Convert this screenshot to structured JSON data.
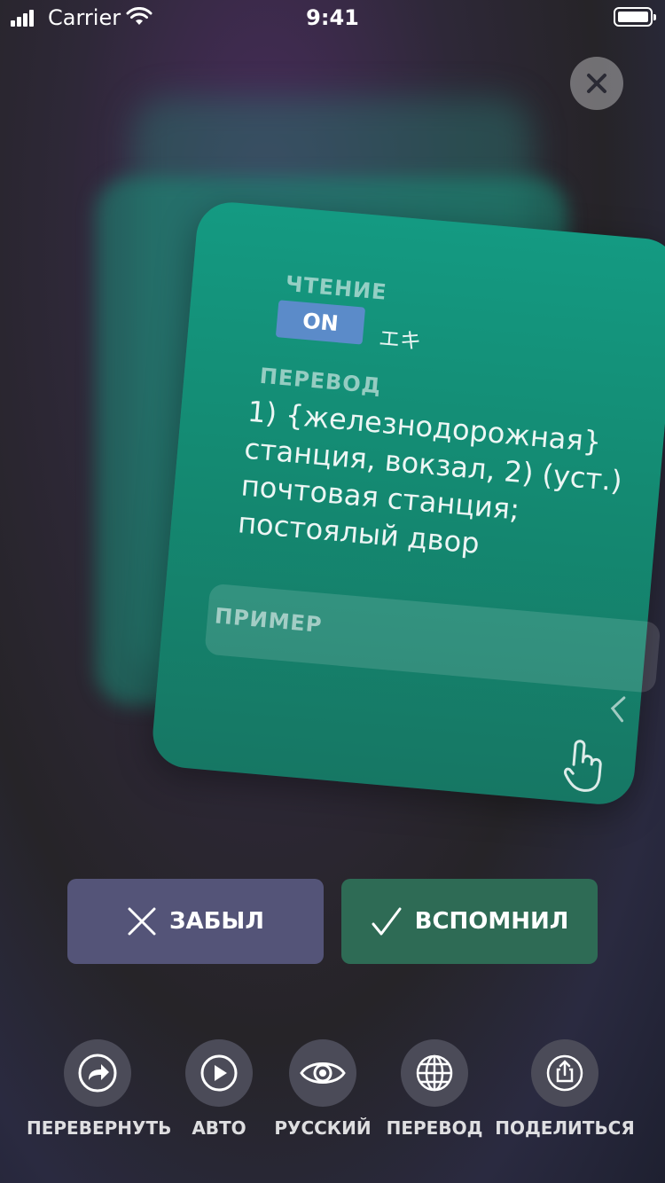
{
  "status_bar": {
    "carrier": "Carrier",
    "time": "9:41"
  },
  "card": {
    "reading_label": "ЧТЕНИЕ",
    "reading_toggle": "ON",
    "reading_value": "エキ",
    "translation_label": "ПЕРЕВОД",
    "translation_text": "1) {железнодорожная} станция, вокзал, 2) (уст.) почтовая станция; постоялый двор",
    "example_label": "ПРИМЕР"
  },
  "actions": {
    "forgot": "ЗАБЫЛ",
    "remember": "ВСПОМНИЛ"
  },
  "toolbar": [
    {
      "label": "ПЕРЕВЕРНУТЬ",
      "icon": "flip-icon"
    },
    {
      "label": "АВТО",
      "icon": "play-icon"
    },
    {
      "label": "РУССКИЙ",
      "icon": "eye-icon"
    },
    {
      "label": "ПЕРЕВОД",
      "icon": "globe-icon"
    },
    {
      "label": "ПОДЕЛИТЬСЯ",
      "icon": "share-icon"
    }
  ],
  "colors": {
    "card": "#149a82",
    "forgot": "#545478",
    "remember": "#2e6b55",
    "toggle": "#5b8bc9"
  }
}
